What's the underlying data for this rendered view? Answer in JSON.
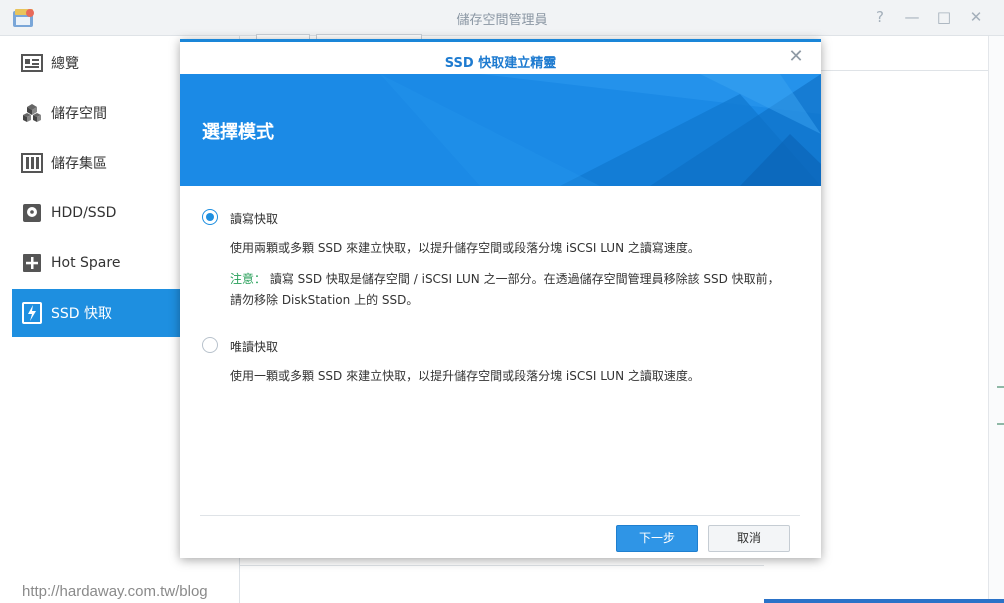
{
  "window": {
    "title": "儲存空間管理員",
    "controls": {
      "help": "?",
      "minimize": "—",
      "maximize": "□",
      "close": "✕"
    }
  },
  "sidebar": {
    "items": [
      {
        "label": "總覽",
        "icon": "overview-icon",
        "active": false
      },
      {
        "label": "儲存空間",
        "icon": "volume-cubes-icon",
        "active": false
      },
      {
        "label": "儲存集區",
        "icon": "storage-pool-icon",
        "active": false
      },
      {
        "label": "HDD/SSD",
        "icon": "disk-icon",
        "active": false
      },
      {
        "label": "Hot Spare",
        "icon": "hot-spare-plus-icon",
        "active": false
      },
      {
        "label": "SSD 快取",
        "icon": "ssd-cache-lightning-icon",
        "active": true
      }
    ]
  },
  "modal": {
    "title": "SSD 快取建立精靈",
    "close": "✕",
    "banner_title": "選擇模式",
    "options": [
      {
        "label": "讀寫快取",
        "checked": true,
        "description": "使用兩顆或多顆 SSD 來建立快取，以提升儲存空間或段落分塊 iSCSI LUN 之讀寫速度。",
        "note_label": "注意：",
        "note_line1": " 讀寫 SSD 快取是儲存空間 / iSCSI LUN 之一部分。在透過儲存空間管理員移除該 SSD 快取前，",
        "note_line2": "請勿移除 DiskStation 上的 SSD。"
      },
      {
        "label": "唯讀快取",
        "checked": false,
        "description": "使用一顆或多顆 SSD 來建立快取，以提升儲存空間或段落分塊 iSCSI LUN 之讀取速度。"
      }
    ],
    "buttons": {
      "next": "下一步",
      "cancel": "取消"
    }
  },
  "watermark": "http://hardaway.com.tw/blog",
  "colors": {
    "accent": "#1e8fe0",
    "banner": "#1b8ae6",
    "note": "#28a05a",
    "title_bar": "#f1f3f5"
  }
}
